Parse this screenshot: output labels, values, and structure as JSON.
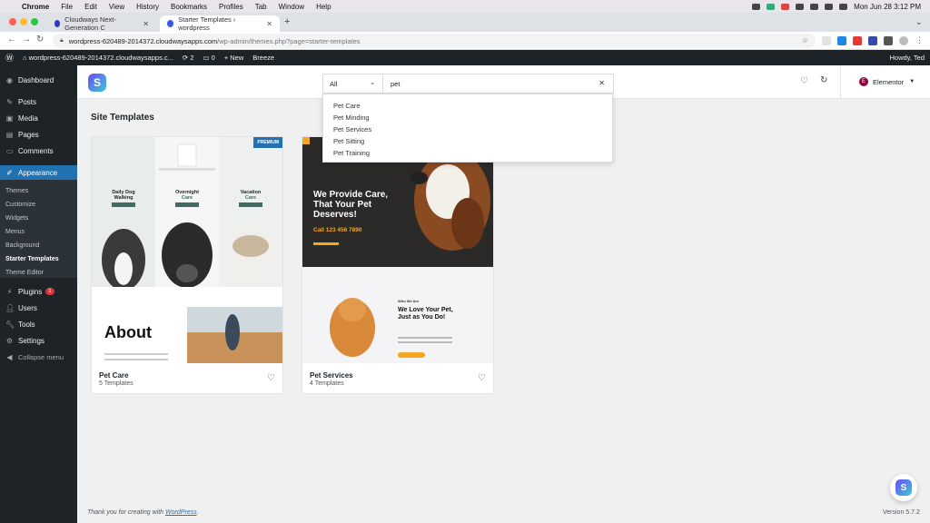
{
  "mac_menu": {
    "app": "Chrome",
    "items": [
      "File",
      "Edit",
      "View",
      "History",
      "Bookmarks",
      "Profiles",
      "Tab",
      "Window",
      "Help"
    ],
    "clock": "Mon Jun 28  3:12 PM"
  },
  "tabs": [
    {
      "title": "Cloudways Next-Generation C",
      "active": false
    },
    {
      "title": "Starter Templates ‹ wordpress",
      "active": true
    }
  ],
  "address": {
    "host": "wordpress-620489-2014372.cloudwaysapps.com",
    "path": "/wp-admin/themes.php?page=starter-templates"
  },
  "wp_admin_bar": {
    "site": "wordpress-620489-2014372.cloudwaysapps.c...",
    "updates": "2",
    "comments": "0",
    "new": "New",
    "breeze": "Breeze",
    "howdy": "Howdy, Ted"
  },
  "sidebar": {
    "items": [
      {
        "label": "Dashboard",
        "icon": "dashboard-icon"
      },
      {
        "label": "Posts",
        "icon": "pin-icon"
      },
      {
        "label": "Media",
        "icon": "media-icon"
      },
      {
        "label": "Pages",
        "icon": "pages-icon"
      },
      {
        "label": "Comments",
        "icon": "comment-icon"
      },
      {
        "label": "Appearance",
        "icon": "brush-icon"
      },
      {
        "label": "Plugins",
        "icon": "plug-icon",
        "badge": "1"
      },
      {
        "label": "Users",
        "icon": "user-icon"
      },
      {
        "label": "Tools",
        "icon": "wrench-icon"
      },
      {
        "label": "Settings",
        "icon": "settings-icon"
      },
      {
        "label": "Collapse menu",
        "icon": "collapse-icon"
      }
    ],
    "submenu": [
      "Themes",
      "Customize",
      "Widgets",
      "Menus",
      "Background",
      "Starter Templates",
      "Theme Editor"
    ]
  },
  "header": {
    "logo": "S",
    "filter_value": "All",
    "search_value": "pet",
    "builder": "Elementor",
    "builder_icon": "E"
  },
  "suggestions": [
    "Pet Care",
    "Pet Minding",
    "Pet Services",
    "Pet Sitting",
    "Pet Training"
  ],
  "content": {
    "title": "Site Templates",
    "cards": [
      {
        "name": "Pet Care",
        "count": "5 Templates",
        "badge": "PREMIUM",
        "thumb": {
          "logo_text": "Dog\nWalking",
          "cols": [
            {
              "title": "Daily Dog",
              "sub": "Walking"
            },
            {
              "title": "Overnight",
              "sub": "Care"
            },
            {
              "title": "Vacation",
              "sub": "Care"
            }
          ],
          "about": "About"
        }
      },
      {
        "name": "Pet Services",
        "count": "4 Templates",
        "thumb": {
          "headline": "We Provide Care, That Your Pet Deserves!",
          "phone": "Call 123 456 7890",
          "who": "Who We Are",
          "headline2": "We Love Your Pet, Just as You Do!"
        }
      }
    ]
  },
  "footer": {
    "text": "Thank you for creating with ",
    "link": "WordPress",
    "suffix": ".",
    "version": "Version 5.7.2"
  },
  "colors": {
    "wp_dark": "#1d2327",
    "wp_blue": "#2271b1",
    "orange": "#f5a623"
  }
}
